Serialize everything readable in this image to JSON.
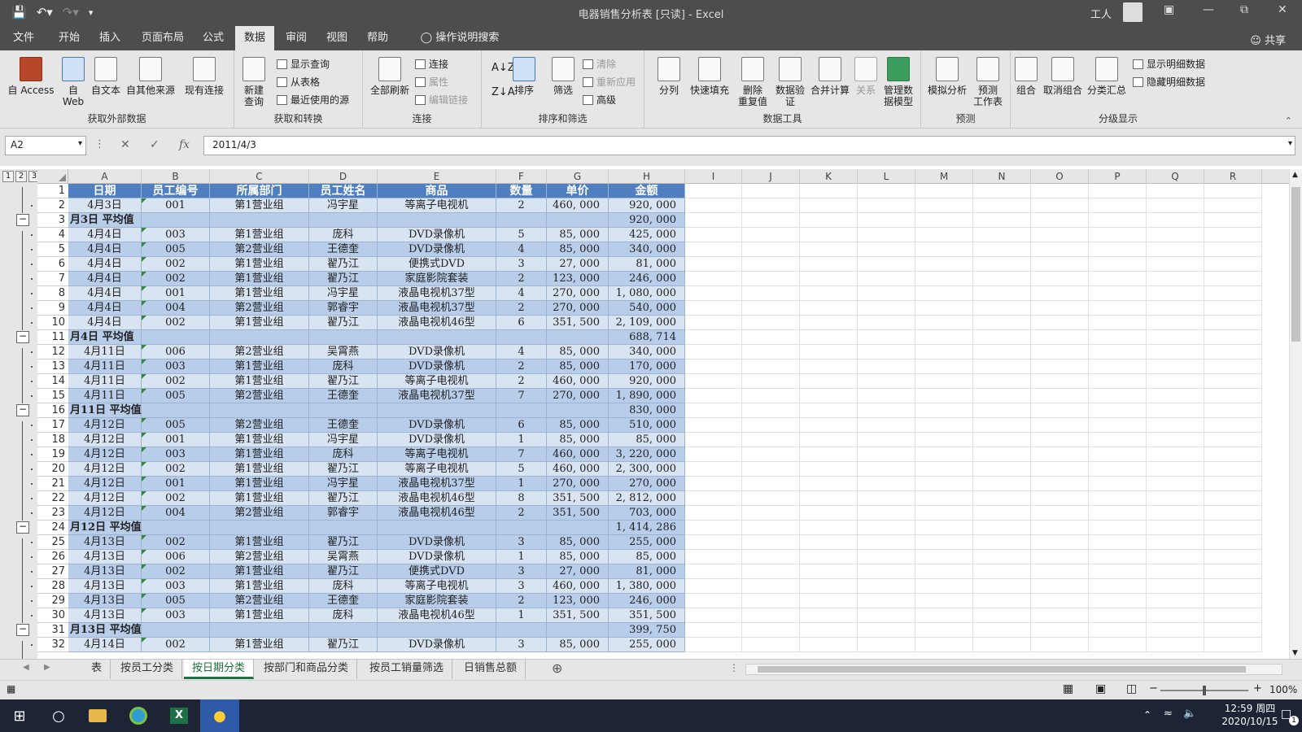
{
  "window": {
    "title": "电器销售分析表  [只读]  -  Excel",
    "user": "工人"
  },
  "tabs": [
    {
      "label": "文件",
      "active": false
    },
    {
      "label": "开始",
      "active": false
    },
    {
      "label": "插入",
      "active": false
    },
    {
      "label": "页面布局",
      "active": false
    },
    {
      "label": "公式",
      "active": false
    },
    {
      "label": "数据",
      "active": true
    },
    {
      "label": "审阅",
      "active": false
    },
    {
      "label": "视图",
      "active": false
    },
    {
      "label": "帮助",
      "active": false
    },
    {
      "label": "操作说明搜索",
      "active": false
    }
  ],
  "share_label": "共享",
  "ribbon": {
    "groups": {
      "external": "获取外部数据",
      "transform": "获取和转换",
      "connections": "连接",
      "sort": "排序和筛选",
      "tools": "数据工具",
      "forecast": "预测",
      "outline": "分级显示"
    },
    "buttons": {
      "access": "自 Access",
      "web_1": "自",
      "web_2": "Web",
      "text": "自文本",
      "other": "自其他来源",
      "existing": "现有连接",
      "newquery_1": "新建",
      "newquery_2": "查询",
      "show_queries": "显示查询",
      "from_table": "从表格",
      "recent": "最近使用的源",
      "refresh": "全部刷新",
      "connections": "连接",
      "properties": "属性",
      "edit_links": "编辑链接",
      "sort": "排序",
      "filter": "筛选",
      "clear": "清除",
      "reapply": "重新应用",
      "advanced": "高级",
      "split": "分列",
      "flash_fill": "快速填充",
      "remove_dup_1": "删除",
      "remove_dup_2": "重复值",
      "validation_1": "数据验",
      "validation_2": "证",
      "consolidate": "合并计算",
      "relations": "关系",
      "model_1": "管理数",
      "model_2": "据模型",
      "whatif": "模拟分析",
      "forecast_1": "预测",
      "forecast_2": "工作表",
      "group": "组合",
      "ungroup": "取消组合",
      "subtotal": "分类汇总",
      "show_detail": "显示明细数据",
      "hide_detail": "隐藏明细数据"
    }
  },
  "formula_bar": {
    "name_box": "A2",
    "formula": "2011/4/3",
    "fx": "fx"
  },
  "columns": [
    "A",
    "B",
    "C",
    "D",
    "E",
    "F",
    "G",
    "H",
    "I",
    "J",
    "K",
    "L",
    "M",
    "N",
    "O",
    "P",
    "Q",
    "R"
  ],
  "outline_levels": [
    "1",
    "2",
    "3"
  ],
  "table_header": [
    "日期",
    "员工编号",
    "所属部门",
    "员工姓名",
    "商品",
    "数量",
    "单价",
    "金额"
  ],
  "rows": [
    {
      "n": "1",
      "type": "header"
    },
    {
      "n": "2",
      "type": "data",
      "cells": [
        "4月3日",
        "001",
        "第1营业组",
        "冯宇星",
        "等离子电视机",
        "2",
        "460, 000",
        "920, 000"
      ]
    },
    {
      "n": "3",
      "type": "sub",
      "label": "月3日  平均值",
      "value": "920, 000"
    },
    {
      "n": "4",
      "type": "data",
      "cells": [
        "4月4日",
        "003",
        "第1营业组",
        "庞科",
        "DVD录像机",
        "5",
        "85, 000",
        "425, 000"
      ]
    },
    {
      "n": "5",
      "type": "data",
      "cells": [
        "4月4日",
        "005",
        "第2营业组",
        "王德奎",
        "DVD录像机",
        "4",
        "85, 000",
        "340, 000"
      ]
    },
    {
      "n": "6",
      "type": "data",
      "cells": [
        "4月4日",
        "002",
        "第1营业组",
        "翟乃江",
        "便携式DVD",
        "3",
        "27, 000",
        "81, 000"
      ]
    },
    {
      "n": "7",
      "type": "data",
      "cells": [
        "4月4日",
        "002",
        "第1营业组",
        "翟乃江",
        "家庭影院套装",
        "2",
        "123, 000",
        "246, 000"
      ]
    },
    {
      "n": "8",
      "type": "data",
      "cells": [
        "4月4日",
        "001",
        "第1营业组",
        "冯宇星",
        "液晶电视机37型",
        "4",
        "270, 000",
        "1, 080, 000"
      ]
    },
    {
      "n": "9",
      "type": "data",
      "cells": [
        "4月4日",
        "004",
        "第2营业组",
        "郭睿宇",
        "液晶电视机37型",
        "2",
        "270, 000",
        "540, 000"
      ]
    },
    {
      "n": "10",
      "type": "data",
      "cells": [
        "4月4日",
        "002",
        "第1营业组",
        "翟乃江",
        "液晶电视机46型",
        "6",
        "351, 500",
        "2, 109, 000"
      ]
    },
    {
      "n": "11",
      "type": "sub",
      "label": "月4日  平均值",
      "value": "688, 714"
    },
    {
      "n": "12",
      "type": "data",
      "cells": [
        "4月11日",
        "006",
        "第2营业组",
        "吴霄燕",
        "DVD录像机",
        "4",
        "85, 000",
        "340, 000"
      ]
    },
    {
      "n": "13",
      "type": "data",
      "cells": [
        "4月11日",
        "003",
        "第1营业组",
        "庞科",
        "DVD录像机",
        "2",
        "85, 000",
        "170, 000"
      ]
    },
    {
      "n": "14",
      "type": "data",
      "cells": [
        "4月11日",
        "002",
        "第1营业组",
        "翟乃江",
        "等离子电视机",
        "2",
        "460, 000",
        "920, 000"
      ]
    },
    {
      "n": "15",
      "type": "data",
      "cells": [
        "4月11日",
        "005",
        "第2营业组",
        "王德奎",
        "液晶电视机37型",
        "7",
        "270, 000",
        "1, 890, 000"
      ]
    },
    {
      "n": "16",
      "type": "sub",
      "label": "月11日  平均值",
      "value": "830, 000"
    },
    {
      "n": "17",
      "type": "data",
      "cells": [
        "4月12日",
        "005",
        "第2营业组",
        "王德奎",
        "DVD录像机",
        "6",
        "85, 000",
        "510, 000"
      ]
    },
    {
      "n": "18",
      "type": "data",
      "cells": [
        "4月12日",
        "001",
        "第1营业组",
        "冯宇星",
        "DVD录像机",
        "1",
        "85, 000",
        "85, 000"
      ]
    },
    {
      "n": "19",
      "type": "data",
      "cells": [
        "4月12日",
        "003",
        "第1营业组",
        "庞科",
        "等离子电视机",
        "7",
        "460, 000",
        "3, 220, 000"
      ]
    },
    {
      "n": "20",
      "type": "data",
      "cells": [
        "4月12日",
        "002",
        "第1营业组",
        "翟乃江",
        "等离子电视机",
        "5",
        "460, 000",
        "2, 300, 000"
      ]
    },
    {
      "n": "21",
      "type": "data",
      "cells": [
        "4月12日",
        "001",
        "第1营业组",
        "冯宇星",
        "液晶电视机37型",
        "1",
        "270, 000",
        "270, 000"
      ]
    },
    {
      "n": "22",
      "type": "data",
      "cells": [
        "4月12日",
        "002",
        "第1营业组",
        "翟乃江",
        "液晶电视机46型",
        "8",
        "351, 500",
        "2, 812, 000"
      ]
    },
    {
      "n": "23",
      "type": "data",
      "cells": [
        "4月12日",
        "004",
        "第2营业组",
        "郭睿宇",
        "液晶电视机46型",
        "2",
        "351, 500",
        "703, 000"
      ]
    },
    {
      "n": "24",
      "type": "sub",
      "label": "月12日  平均值",
      "value": "1, 414, 286"
    },
    {
      "n": "25",
      "type": "data",
      "cells": [
        "4月13日",
        "002",
        "第1营业组",
        "翟乃江",
        "DVD录像机",
        "3",
        "85, 000",
        "255, 000"
      ]
    },
    {
      "n": "26",
      "type": "data",
      "cells": [
        "4月13日",
        "006",
        "第2营业组",
        "吴霄燕",
        "DVD录像机",
        "1",
        "85, 000",
        "85, 000"
      ]
    },
    {
      "n": "27",
      "type": "data",
      "cells": [
        "4月13日",
        "002",
        "第1营业组",
        "翟乃江",
        "便携式DVD",
        "3",
        "27, 000",
        "81, 000"
      ]
    },
    {
      "n": "28",
      "type": "data",
      "cells": [
        "4月13日",
        "003",
        "第1营业组",
        "庞科",
        "等离子电视机",
        "3",
        "460, 000",
        "1, 380, 000"
      ]
    },
    {
      "n": "29",
      "type": "data",
      "cells": [
        "4月13日",
        "005",
        "第2营业组",
        "王德奎",
        "家庭影院套装",
        "2",
        "123, 000",
        "246, 000"
      ]
    },
    {
      "n": "30",
      "type": "data",
      "cells": [
        "4月13日",
        "003",
        "第1营业组",
        "庞科",
        "液晶电视机46型",
        "1",
        "351, 500",
        "351, 500"
      ]
    },
    {
      "n": "31",
      "type": "sub",
      "label": "月13日  平均值",
      "value": "399, 750"
    },
    {
      "n": "32",
      "type": "data",
      "cells": [
        "4月14日",
        "002",
        "第1营业组",
        "翟乃江",
        "DVD录像机",
        "3",
        "85, 000",
        "255, 000"
      ]
    }
  ],
  "sheet_tabs": [
    {
      "label": "表",
      "active": false
    },
    {
      "label": "按员工分类",
      "active": false
    },
    {
      "label": "按日期分类",
      "active": true
    },
    {
      "label": "按部门和商品分类",
      "active": false
    },
    {
      "label": "按员工销量筛选",
      "active": false
    },
    {
      "label": "日销售总额",
      "active": false
    }
  ],
  "status": {
    "zoom": "100%",
    "zoom_fraction": 0.5
  },
  "taskbar": {
    "time": "12:59 周四",
    "date": "2020/10/15",
    "notifications": "1"
  }
}
